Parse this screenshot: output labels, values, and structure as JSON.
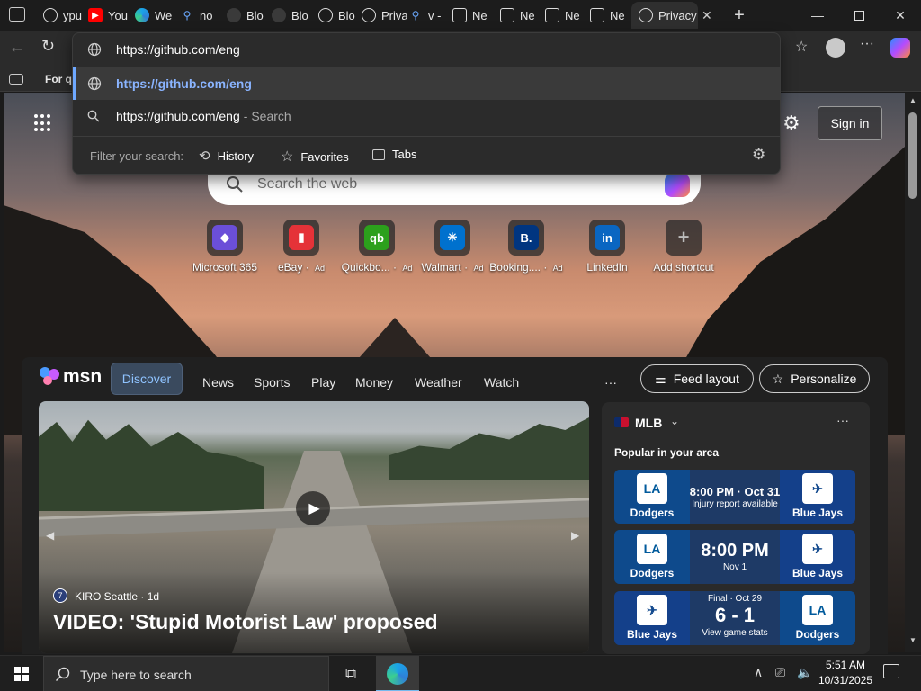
{
  "browser": {
    "tabs": [
      {
        "label": "ypu",
        "favicon": "globe-icon"
      },
      {
        "label": "You",
        "favicon": "youtube-icon"
      },
      {
        "label": "We",
        "favicon": "edge-icon"
      },
      {
        "label": "no",
        "favicon": "search-icon"
      },
      {
        "label": "Blo",
        "favicon": "github-icon"
      },
      {
        "label": "Blo",
        "favicon": "github-icon"
      },
      {
        "label": "Blo",
        "favicon": "globe-icon"
      },
      {
        "label": "Privacy",
        "favicon": "globe-icon"
      },
      {
        "label": "v -",
        "favicon": "search-icon"
      },
      {
        "label": "Ne",
        "favicon": "newtab-icon"
      },
      {
        "label": "Ne",
        "favicon": "newtab-icon"
      },
      {
        "label": "Ne",
        "favicon": "newtab-icon"
      },
      {
        "label": "Ne",
        "favicon": "newtab-icon"
      },
      {
        "label": "Privacy",
        "favicon": "globe-icon"
      }
    ],
    "address_value": "https://github.com/eng",
    "favbar_text": "For qu"
  },
  "dropdown": {
    "suggestion_url": "https://github.com/eng",
    "search_query": "https://github.com/eng",
    "search_suffix": "- Search",
    "filter_label": "Filter your search:",
    "filters": [
      "History",
      "Favorites",
      "Tabs"
    ]
  },
  "newtab": {
    "signin_label": "Sign in",
    "search_placeholder": "Search the web",
    "shortcuts": [
      {
        "label": "Microsoft 365",
        "ad": "",
        "color": "#6b4fd8",
        "glyph": "◆"
      },
      {
        "label": "eBay",
        "ad": "Ad",
        "color": "#e53238",
        "glyph": "▮"
      },
      {
        "label": "Quickbo...",
        "ad": "Ad",
        "color": "#2ca01c",
        "glyph": "qb"
      },
      {
        "label": "Walmart",
        "ad": "Ad",
        "color": "#0071ce",
        "glyph": "✳"
      },
      {
        "label": "Booking....",
        "ad": "Ad",
        "color": "#003580",
        "glyph": "B."
      },
      {
        "label": "LinkedIn",
        "ad": "",
        "color": "#0a66c2",
        "glyph": "in"
      },
      {
        "label": "Add shortcut",
        "ad": "",
        "color": "#555555",
        "glyph": "+"
      }
    ]
  },
  "msn": {
    "brand": "msn",
    "nav": [
      "Discover",
      "News",
      "Sports",
      "Play",
      "Money",
      "Weather",
      "Watch"
    ],
    "more": "···",
    "feed_layout": "Feed layout",
    "personalize": "Personalize",
    "hero": {
      "source": "KIRO Seattle",
      "age": "· 1d",
      "headline": "VIDEO: 'Stupid Motorist Law' proposed"
    },
    "mlb": {
      "title": "MLB",
      "subtitle": "Popular in your area",
      "games": [
        {
          "left": "Dodgers",
          "left_logo": "LA",
          "right": "Blue Jays",
          "right_logo": "✈",
          "line1": "8:00 PM · Oct 31",
          "line2": "Injury report available"
        },
        {
          "left": "Dodgers",
          "left_logo": "LA",
          "right": "Blue Jays",
          "right_logo": "✈",
          "line1": "8:00 PM",
          "line2": "Nov 1"
        },
        {
          "left": "Blue Jays",
          "left_logo": "✈",
          "right": "Dodgers",
          "right_logo": "LA",
          "line0": "Final · Oct 29",
          "line1": "6 - 1",
          "line2": "View game stats"
        }
      ]
    }
  },
  "taskbar": {
    "search_placeholder": "Type here to search",
    "time": "5:51 AM",
    "date": "10/31/2025"
  }
}
